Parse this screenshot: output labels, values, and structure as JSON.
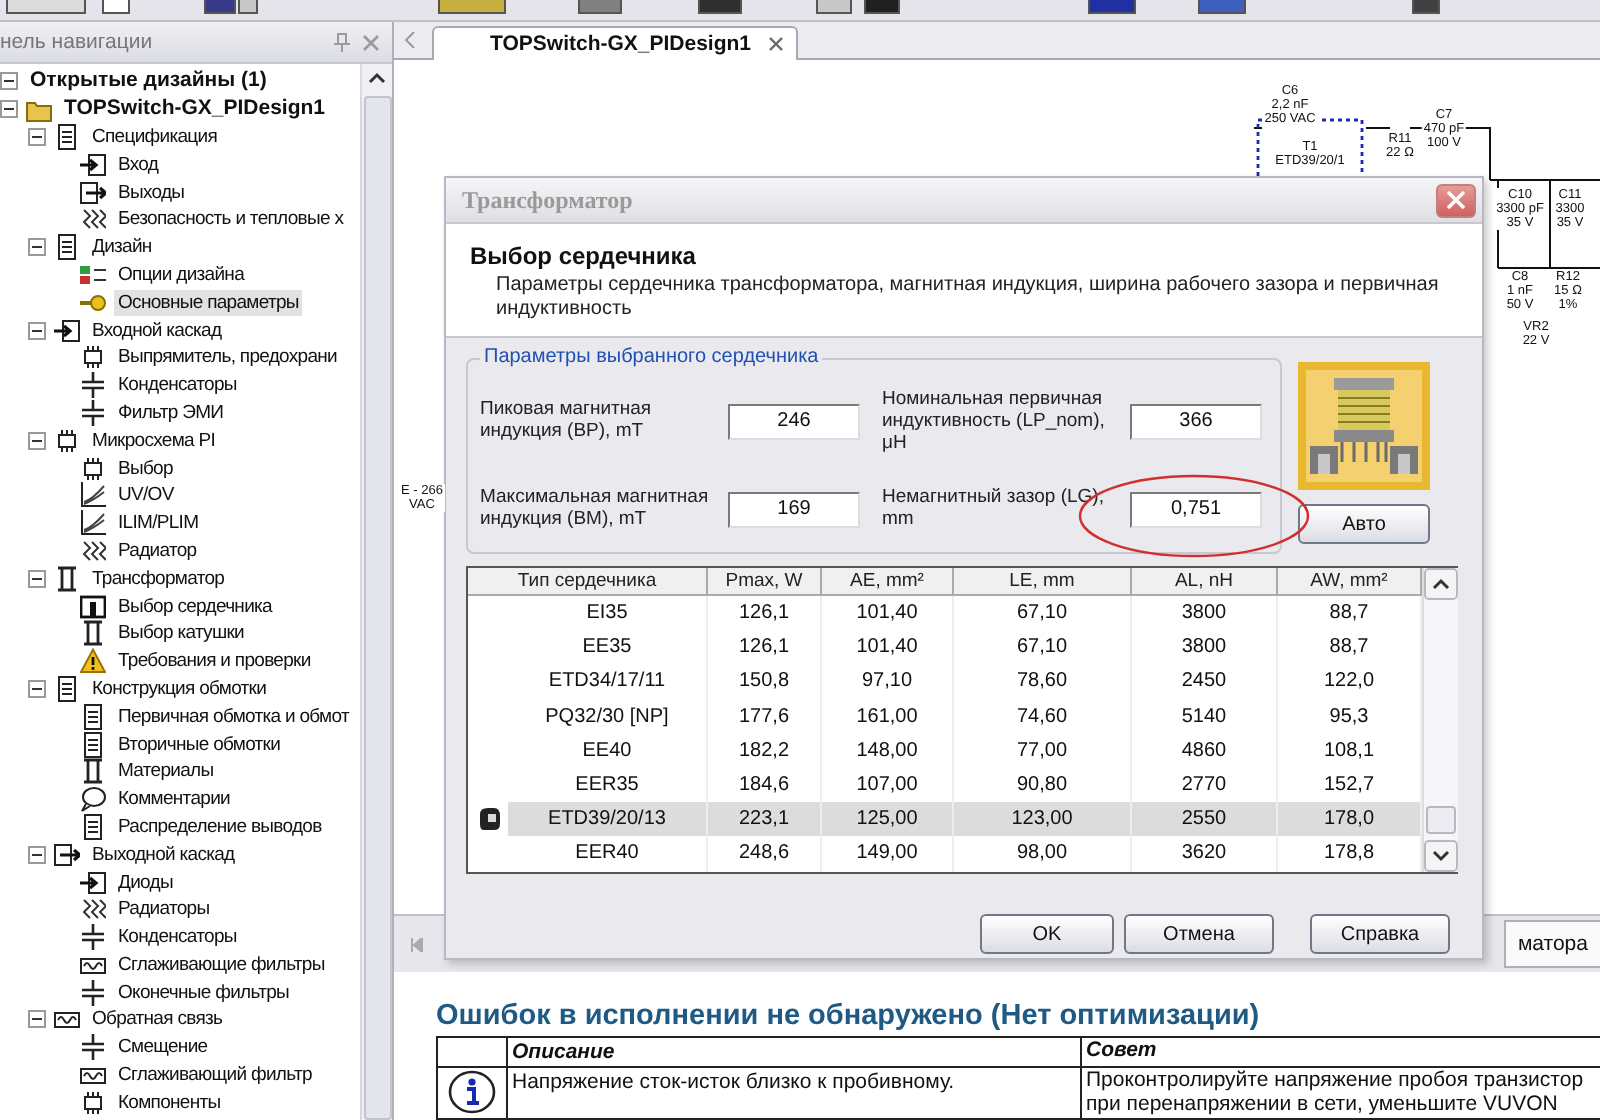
{
  "navigation_panel": {
    "title": "нель навигации",
    "tree": [
      {
        "label": "Открытые дизайны (1)",
        "expanded": true,
        "selected": false,
        "children": [
          {
            "label": "TOPSwitch-GX_PIDesign1",
            "expanded": true,
            "selected": false,
            "children": [
              {
                "label": "Спецификация",
                "expanded": true,
                "selected": false,
                "children": [
                  {
                    "label": "Вход",
                    "selected": false
                  },
                  {
                    "label": "Выходы",
                    "selected": false
                  },
                  {
                    "label": "Безопасность и тепловые х",
                    "selected": false
                  }
                ]
              },
              {
                "label": "Дизайн",
                "expanded": true,
                "selected": false,
                "children": [
                  {
                    "label": "Опции дизайна",
                    "selected": false
                  },
                  {
                    "label": "Основные параметры",
                    "selected": true
                  }
                ]
              },
              {
                "label": "Входной каскад",
                "expanded": true,
                "selected": false,
                "children": [
                  {
                    "label": "Выпрямитель, предохрани",
                    "selected": false
                  },
                  {
                    "label": "Конденсаторы",
                    "selected": false
                  },
                  {
                    "label": "Фильтр ЭМИ",
                    "selected": false
                  }
                ]
              },
              {
                "label": "Микросхема PI",
                "expanded": true,
                "selected": false,
                "children": [
                  {
                    "label": "Выбор",
                    "selected": false
                  },
                  {
                    "label": "UV/OV",
                    "selected": false
                  },
                  {
                    "label": "ILIM/PLIM",
                    "selected": false
                  },
                  {
                    "label": "Радиатор",
                    "selected": false
                  }
                ]
              },
              {
                "label": "Трансформатор",
                "expanded": true,
                "selected": false,
                "children": [
                  {
                    "label": "Выбор сердечника",
                    "selected": false
                  },
                  {
                    "label": "Выбор катушки",
                    "selected": false
                  },
                  {
                    "label": "Требования и проверки",
                    "selected": false
                  }
                ]
              },
              {
                "label": "Конструкция обмотки",
                "expanded": true,
                "selected": false,
                "children": [
                  {
                    "label": "Первичная обмотка и обмот",
                    "selected": false
                  },
                  {
                    "label": "Вторичные обмотки",
                    "selected": false
                  },
                  {
                    "label": "Материалы",
                    "selected": false
                  },
                  {
                    "label": "Комментарии",
                    "selected": false
                  },
                  {
                    "label": "Распределение выводов",
                    "selected": false
                  }
                ]
              },
              {
                "label": "Выходной каскад",
                "expanded": true,
                "selected": false,
                "children": [
                  {
                    "label": "Диоды",
                    "selected": false
                  },
                  {
                    "label": "Радиаторы",
                    "selected": false
                  },
                  {
                    "label": "Конденсаторы",
                    "selected": false
                  },
                  {
                    "label": "Сглаживающие фильтры",
                    "selected": false
                  },
                  {
                    "label": "Оконечные фильтры",
                    "selected": false
                  }
                ]
              },
              {
                "label": "Обратная связь",
                "expanded": true,
                "selected": false,
                "children": [
                  {
                    "label": "Смещение",
                    "selected": false
                  },
                  {
                    "label": "Сглаживающий фильтр",
                    "selected": false
                  },
                  {
                    "label": "Компоненты",
                    "selected": false
                  }
                ]
              }
            ]
          }
        ]
      }
    ]
  },
  "document_tabs": [
    {
      "label": "TOPSwitch-GX_PIDesign1",
      "selected": true
    }
  ],
  "schematic": {
    "labels": [
      {
        "lines": [
          "C6",
          "2,2 nF",
          "250 VAC"
        ]
      },
      {
        "lines": [
          "C7",
          "470 pF",
          "100 V"
        ]
      },
      {
        "lines": [
          "R11",
          "22 Ω"
        ]
      },
      {
        "lines": [
          "T1",
          "ETD39/20/1"
        ]
      },
      {
        "lines": [
          "C10",
          "3300 pF",
          "35 V"
        ]
      },
      {
        "lines": [
          "C11",
          "3300",
          "35 V"
        ]
      },
      {
        "lines": [
          "C8",
          "1 nF",
          "50 V"
        ]
      },
      {
        "lines": [
          "R12",
          "15 Ω",
          "1%"
        ]
      },
      {
        "lines": [
          "VR2",
          "22 V"
        ]
      },
      {
        "lines": [
          "E - 266",
          "VAC"
        ]
      }
    ]
  },
  "view_tabs": [
    {
      "label": "матора",
      "selected": true
    }
  ],
  "report": {
    "heading": "Ошибок в исполнении не обнаружено (Нет оптимизации)",
    "columns": [
      "Описание",
      "Совет"
    ],
    "rows": [
      {
        "kind": "info",
        "description": "Напряжение сток-исток близко к пробивному.",
        "advice": [
          "Проконтролируйте напряжение пробоя транзистор",
          "при перенапряжении в сети, уменьшите VUVON"
        ]
      }
    ]
  },
  "dialog": {
    "title": "Трансформатор",
    "heading": "Выбор сердечника",
    "description": "Параметры сердечника трансформатора, магнитная индукция, ширина рабочего зазора и первичная индуктивность",
    "group_title": "Параметры выбранного сердечника",
    "fields": [
      {
        "label": "Пиковая магнитная индукция (BP), mT",
        "value": "246",
        "circled": false
      },
      {
        "label": "Номинальная первичная индуктивность (LP_nom), μH",
        "value": "366",
        "circled": false
      },
      {
        "label": "Максимальная магнитная индукция (BM), mT",
        "value": "169",
        "circled": false
      },
      {
        "label": "Немагнитный зазор (LG), mm",
        "value": "0,751",
        "circled": true
      }
    ],
    "auto_button": "Авто",
    "table": {
      "columns": [
        "Тип сердечника",
        "Pmax, W",
        "AE, mm²",
        "LE, mm",
        "AL, nH",
        "AW, mm²"
      ],
      "rows": [
        {
          "cells": [
            "EI35",
            "126,1",
            "101,40",
            "67,10",
            "3800",
            "88,7"
          ],
          "selected": false
        },
        {
          "cells": [
            "EE35",
            "126,1",
            "101,40",
            "67,10",
            "3800",
            "88,7"
          ],
          "selected": false
        },
        {
          "cells": [
            "ETD34/17/11",
            "150,8",
            "97,10",
            "78,60",
            "2450",
            "122,0"
          ],
          "selected": false
        },
        {
          "cells": [
            "PQ32/30 [NP]",
            "177,6",
            "161,00",
            "74,60",
            "5140",
            "95,3"
          ],
          "selected": false
        },
        {
          "cells": [
            "EE40",
            "182,2",
            "148,00",
            "77,00",
            "4860",
            "108,1"
          ],
          "selected": false
        },
        {
          "cells": [
            "EER35",
            "184,6",
            "107,00",
            "90,80",
            "2770",
            "152,7"
          ],
          "selected": false
        },
        {
          "cells": [
            "ETD39/20/13",
            "223,1",
            "125,00",
            "123,00",
            "2550",
            "178,0"
          ],
          "selected": true
        },
        {
          "cells": [
            "EER40",
            "248,6",
            "149,00",
            "98,00",
            "3620",
            "178,8"
          ],
          "selected": false
        }
      ]
    },
    "buttons": [
      "OK",
      "Отмена",
      "Справка"
    ]
  }
}
